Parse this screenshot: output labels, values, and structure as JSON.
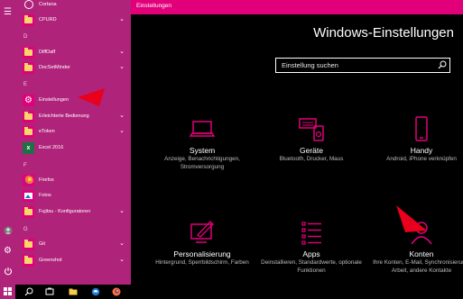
{
  "start_menu": {
    "rail_icons": [
      "hamburger-icon",
      "user-icon",
      "gear-icon",
      "power-icon"
    ],
    "rows": [
      {
        "type": "app",
        "label": "Cortana",
        "icon": "cortana-icon"
      },
      {
        "type": "app",
        "label": "CPURD",
        "icon": "folder-icon",
        "expand": true
      },
      {
        "type": "letter",
        "label": "D"
      },
      {
        "type": "app",
        "label": "DiffDaff",
        "icon": "folder-icon",
        "expand": true
      },
      {
        "type": "app",
        "label": "DocSetMinder",
        "icon": "folder-icon",
        "expand": true
      },
      {
        "type": "letter",
        "label": "E"
      },
      {
        "type": "app",
        "label": "Einstellungen",
        "icon": "gear-icon"
      },
      {
        "type": "app",
        "label": "Erleichterte Bedienung",
        "icon": "folder-icon",
        "expand": true
      },
      {
        "type": "app",
        "label": "eToken",
        "icon": "folder-icon",
        "expand": true
      },
      {
        "type": "app",
        "label": "Excel 2016",
        "icon": "excel-icon"
      },
      {
        "type": "letter",
        "label": "F"
      },
      {
        "type": "app",
        "label": "Firefox",
        "icon": "firefox-icon"
      },
      {
        "type": "app",
        "label": "Fotos",
        "icon": "photos-icon"
      },
      {
        "type": "app",
        "label": "Fujitsu - Konfiguratoren",
        "icon": "folder-icon",
        "expand": true
      },
      {
        "type": "letter",
        "label": "G"
      },
      {
        "type": "app",
        "label": "Git",
        "icon": "folder-icon",
        "expand": true
      },
      {
        "type": "app",
        "label": "Greenshot",
        "icon": "folder-icon",
        "expand": true
      }
    ]
  },
  "settings": {
    "window_title": "Einstellungen",
    "page_title": "Windows-Einstellungen",
    "search": {
      "placeholder": "Einstellung suchen",
      "value": ""
    },
    "categories": [
      {
        "title": "System",
        "desc": "Anzeige, Benachrichtigungen, Stromversorgung",
        "icon": "laptop-icon"
      },
      {
        "title": "Geräte",
        "desc": "Bluetooth, Drucker, Maus",
        "icon": "devices-icon"
      },
      {
        "title": "Handy",
        "desc": "Android, iPhone verknüpfen",
        "icon": "phone-icon"
      },
      {
        "title": "Personalisierung",
        "desc": "Hintergrund, Sperrbildschirm, Farben",
        "icon": "personalization-icon"
      },
      {
        "title": "Apps",
        "desc": "Deinstallieren, Standardwerte, optionale Funktionen",
        "icon": "apps-icon"
      },
      {
        "title": "Konten",
        "desc": "Ihre Konten, E-Mail, Synchronisierung, Arbeit, andere Kontakte",
        "icon": "accounts-icon"
      }
    ]
  },
  "taskbar": {
    "icons": [
      "search-icon",
      "task-view-icon",
      "file-explorer-icon",
      "edge-icon",
      "firefox-icon"
    ]
  },
  "colors": {
    "accent": "#e2007a",
    "start_menu_bg": "#b0237a",
    "annotation_arrow": "#e8001c"
  }
}
